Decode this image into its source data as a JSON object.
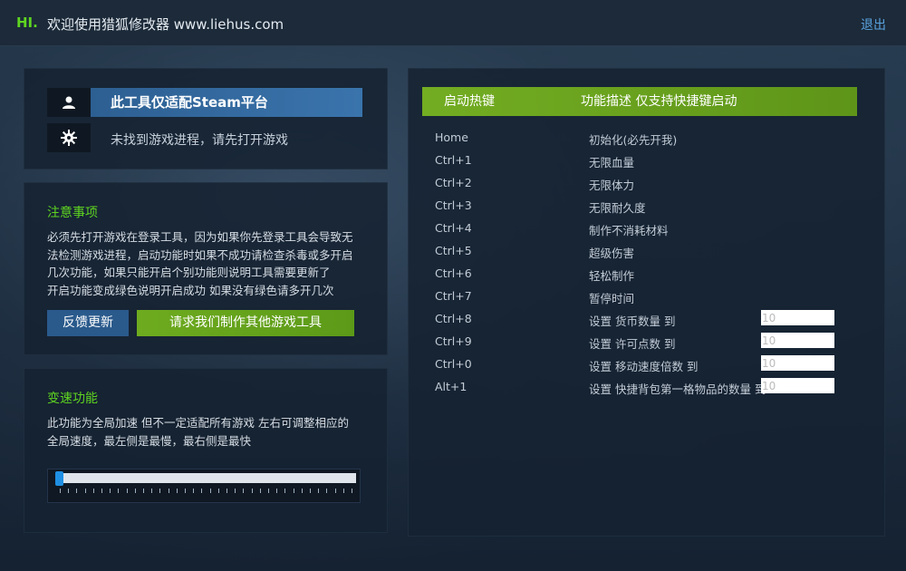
{
  "header": {
    "hi": "HI.",
    "title": "欢迎使用猎狐修改器 www.liehus.com",
    "exit": "退出"
  },
  "platform": {
    "label": "此工具仅适配Steam平台",
    "status": "未找到游戏进程，请先打开游戏"
  },
  "notice": {
    "title": "注意事项",
    "lines": [
      "必须先打开游戏在登录工具，因为如果你先登录工具会导致无",
      "法检测游戏进程，启动功能时如果不成功请检查杀毒或多开启",
      "几次功能，如果只能开启个别功能则说明工具需要更新了",
      "开启功能变成绿色说明开启成功 如果没有绿色请多开几次"
    ],
    "feedback_btn": "反馈更新",
    "request_btn": "请求我们制作其他游戏工具"
  },
  "speed": {
    "title": "变速功能",
    "lines": [
      "此功能为全局加速 但不一定适配所有游戏 左右可调整相应的",
      "全局速度，最左侧是最慢，最右侧是最快"
    ],
    "slider_value": 0
  },
  "hotkeys": {
    "header_key": "启动热键",
    "header_desc": "功能描述 仅支持快捷键启动",
    "rows": [
      {
        "key": "Home",
        "desc": "初始化(必先开我)"
      },
      {
        "key": "Ctrl+1",
        "desc": "无限血量"
      },
      {
        "key": "Ctrl+2",
        "desc": "无限体力"
      },
      {
        "key": "Ctrl+3",
        "desc": "无限耐久度"
      },
      {
        "key": "Ctrl+4",
        "desc": "制作不消耗材料"
      },
      {
        "key": "Ctrl+5",
        "desc": "超级伤害"
      },
      {
        "key": "Ctrl+6",
        "desc": "轻松制作"
      },
      {
        "key": "Ctrl+7",
        "desc": "暂停时间"
      },
      {
        "key": "Ctrl+8",
        "desc": "设置 货币数量 到",
        "input": "10"
      },
      {
        "key": "Ctrl+9",
        "desc": "设置 许可点数 到",
        "input": "10"
      },
      {
        "key": "Ctrl+0",
        "desc": "设置 移动速度倍数 到",
        "input": "10"
      },
      {
        "key": "Alt+1",
        "desc": "设置 快捷背包第一格物品的数量 到",
        "input": "10"
      }
    ]
  },
  "colors": {
    "accent_green": "#5ed420",
    "accent_blue": "#2d5f92",
    "slider_thumb": "#1f8fe3"
  }
}
